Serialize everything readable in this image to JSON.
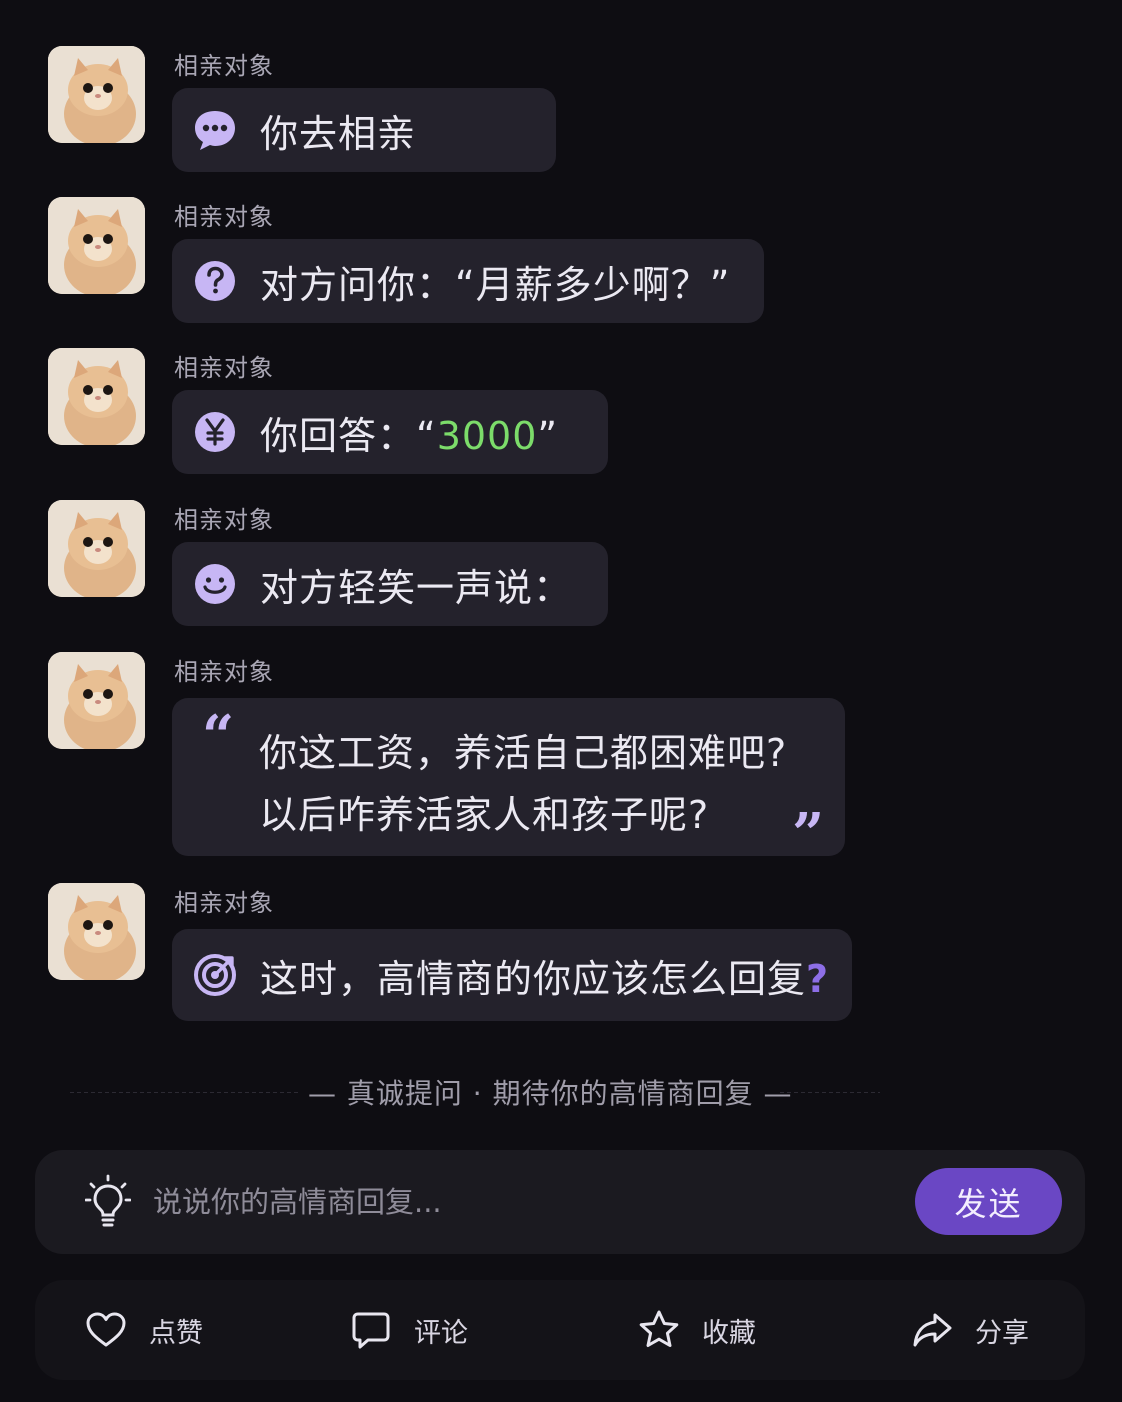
{
  "sender_name": "相亲对象",
  "messages": [
    {
      "icon": "chat-bubble-icon",
      "text": "你去相亲"
    },
    {
      "icon": "question-icon",
      "text": "对方问你：“月薪多少啊？”"
    },
    {
      "icon": "yuan-icon",
      "text_prefix": "你回答：“",
      "text_highlight": "3000",
      "text_suffix": "”"
    },
    {
      "icon": "smile-icon",
      "text": "对方轻笑一声说："
    },
    {
      "icon": "quote-icon",
      "lines": [
        "你这工资，养活自己都困难吧?",
        "以后咋养活家人和孩子呢?"
      ]
    },
    {
      "icon": "target-icon",
      "text": "这时，高情商的你应该怎么回复",
      "text_suffix": "?"
    }
  ],
  "divider": {
    "text": "—  真诚提问 · 期待你的高情商回复  —"
  },
  "input": {
    "placeholder": "说说你的高情商回复...",
    "value": "",
    "send_label": "发送"
  },
  "actions": [
    {
      "icon": "heart-icon",
      "label": "点赞"
    },
    {
      "icon": "comment-icon",
      "label": "评论"
    },
    {
      "icon": "star-icon",
      "label": "收藏"
    },
    {
      "icon": "share-icon",
      "label": "分享"
    }
  ],
  "colors": {
    "background": "#0e0d12",
    "bubble": "#24222c",
    "accent": "#6a47c4",
    "icon_purple": "#c7b6f4",
    "highlight_green": "#7cdc6a"
  }
}
